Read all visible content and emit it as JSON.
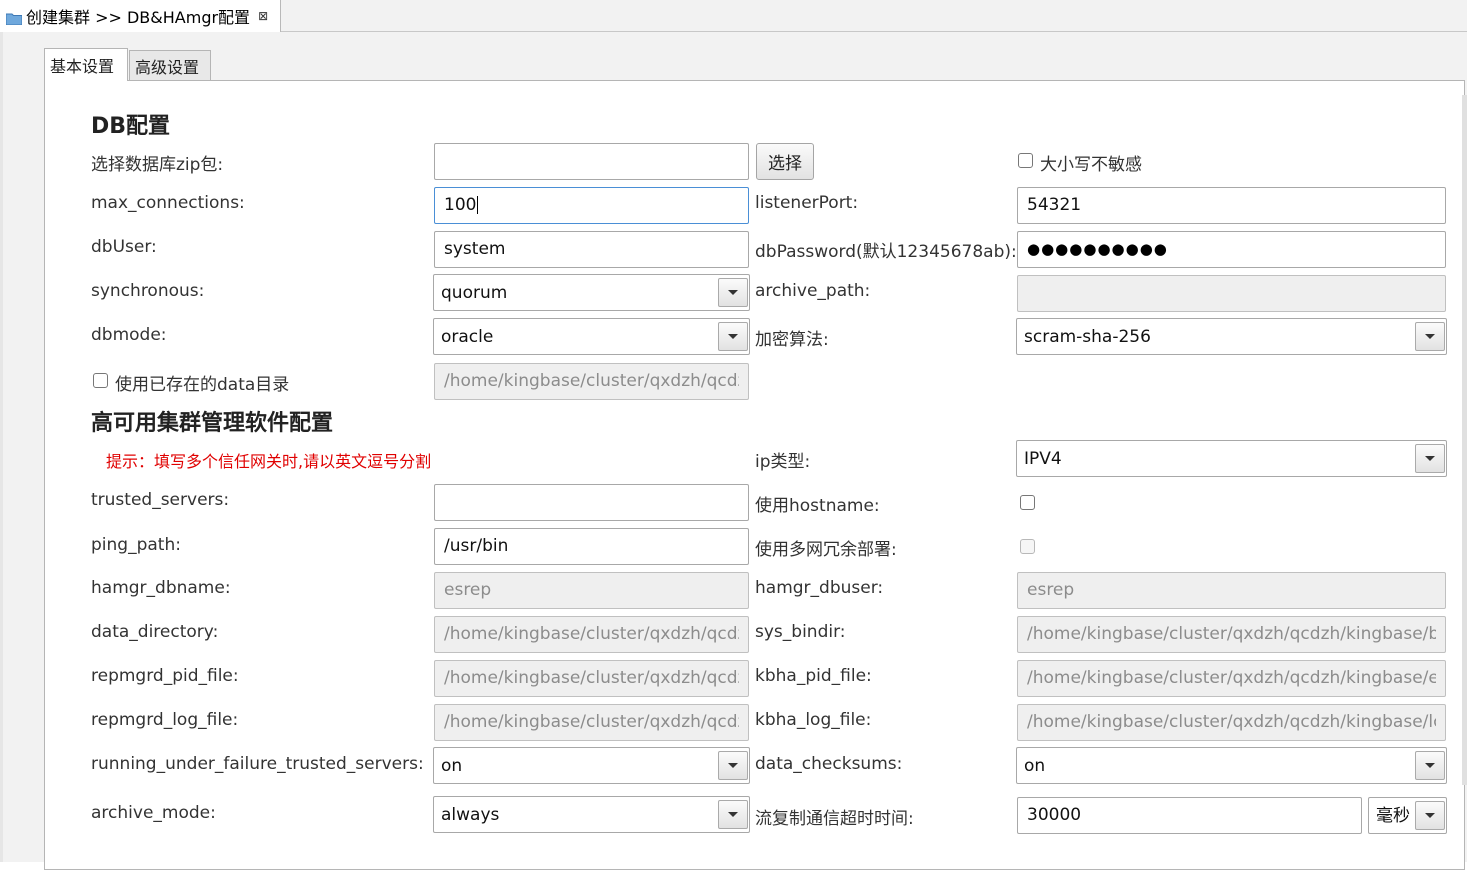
{
  "editor_tab": {
    "title": "创建集群 >> DB&HAmgr配置",
    "close_glyph": "⊠",
    "icon": "folder-icon"
  },
  "tabs": [
    {
      "label": "基本设置",
      "active": true
    },
    {
      "label": "高级设置",
      "active": false
    }
  ],
  "db_section": {
    "title": "DB配置",
    "zip_label": "选择数据库zip包:",
    "zip_value": "",
    "choose_button": "选择",
    "case_insensitive_label": "大小写不敏感",
    "case_insensitive_checked": false,
    "max_connections_label": "max_connections:",
    "max_connections_value": "100",
    "listener_port_label": "listenerPort:",
    "listener_port_value": "54321",
    "db_user_label": "dbUser:",
    "db_user_value": "system",
    "db_password_label": "dbPassword(默认12345678ab):",
    "db_password_mask": "●●●●●●●●●●",
    "synchronous_label": "synchronous:",
    "synchronous_value": "quorum",
    "archive_path_label": "archive_path:",
    "archive_path_value": "",
    "dbmode_label": "dbmode:",
    "dbmode_value": "oracle",
    "encryption_label": "加密算法:",
    "encryption_value": "scram-sha-256",
    "use_existing_data_label": "使用已存在的data目录",
    "use_existing_data_checked": false,
    "existing_data_path": "/home/kingbase/cluster/qxdzh/qcdz"
  },
  "ha_section": {
    "title": "高可用集群管理软件配置",
    "hint": "提示：填写多个信任网关时,请以英文逗号分割",
    "ip_type_label": "ip类型:",
    "ip_type_value": "IPV4",
    "trusted_servers_label": "trusted_servers:",
    "trusted_servers_value": "",
    "use_hostname_label": "使用hostname:",
    "use_hostname_checked": false,
    "ping_path_label": "ping_path:",
    "ping_path_value": "/usr/bin",
    "multi_net_label": "使用多网冗余部署:",
    "multi_net_checked": false,
    "hamgr_dbname_label": "hamgr_dbname:",
    "hamgr_dbname_value": "esrep",
    "hamgr_dbuser_label": "hamgr_dbuser:",
    "hamgr_dbuser_value": "esrep",
    "data_directory_label": "data_directory:",
    "data_directory_value": "/home/kingbase/cluster/qxdzh/qcdz",
    "sys_bindir_label": "sys_bindir:",
    "sys_bindir_value": "/home/kingbase/cluster/qxdzh/qcdzh/kingbase/b",
    "repmgrd_pid_label": "repmgrd_pid_file:",
    "repmgrd_pid_value": "/home/kingbase/cluster/qxdzh/qcdz",
    "kbha_pid_label": "kbha_pid_file:",
    "kbha_pid_value": "/home/kingbase/cluster/qxdzh/qcdzh/kingbase/e",
    "repmgrd_log_label": "repmgrd_log_file:",
    "repmgrd_log_value": "/home/kingbase/cluster/qxdzh/qcdz",
    "kbha_log_label": "kbha_log_file:",
    "kbha_log_value": "/home/kingbase/cluster/qxdzh/qcdzh/kingbase/lc",
    "running_under_failure_label": "running_under_failure_trusted_servers:",
    "running_under_failure_value": "on",
    "data_checksums_label": "data_checksums:",
    "data_checksums_value": "on",
    "archive_mode_label": "archive_mode:",
    "archive_mode_value": "always",
    "stream_timeout_label": "流复制通信超时时间:",
    "stream_timeout_value": "30000",
    "stream_timeout_unit": "毫秒"
  }
}
